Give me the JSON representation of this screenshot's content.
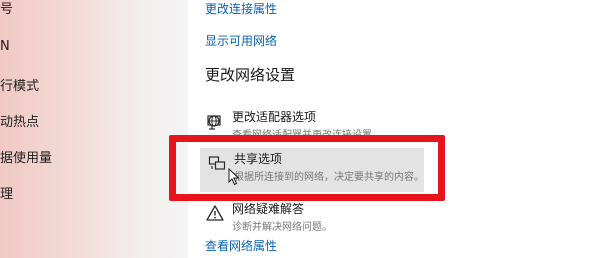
{
  "sidebar": {
    "items": [
      {
        "label": "号"
      },
      {
        "label": "N"
      },
      {
        "label": "行模式"
      },
      {
        "label": "动热点"
      },
      {
        "label": "据使用量"
      },
      {
        "label": "理"
      }
    ]
  },
  "main": {
    "links": {
      "change_connection_properties": "更改连接属性",
      "show_available_networks": "显示可用网络",
      "view_network_properties": "查看网络属性"
    },
    "section_title": "更改网络设置",
    "options": [
      {
        "icon": "adapter-globe-icon",
        "title": "更改适配器选项",
        "description": "查看网络适配器并更改连接设置。"
      },
      {
        "icon": "sharing-icon",
        "title": "共享选项",
        "description": "根据所连接到的网络，决定要共享的内容。"
      },
      {
        "icon": "warning-icon",
        "title": "网络疑难解答",
        "description": "诊断并解决网络问题。"
      }
    ]
  },
  "annotation": {
    "highlight_color": "#e8141c"
  }
}
